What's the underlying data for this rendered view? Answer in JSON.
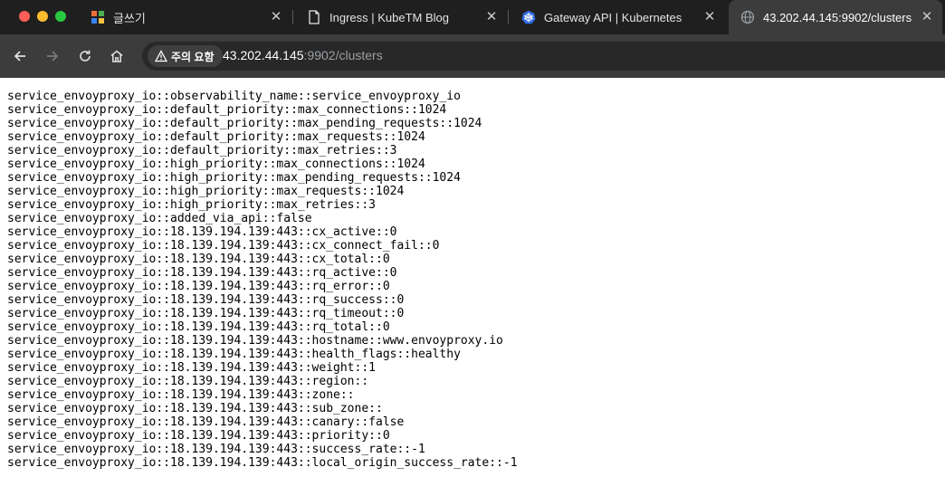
{
  "browser": {
    "tabs": [
      {
        "title": "글쓰기",
        "icon": "grid-app-icon"
      },
      {
        "title": "Ingress | KubeTM Blog",
        "icon": "document-icon"
      },
      {
        "title": "Gateway API | Kubernetes",
        "icon": "kubernetes-icon"
      },
      {
        "title": "43.202.44.145:9902/clusters",
        "icon": "globe-icon"
      }
    ],
    "security_chip": "주의 요함",
    "url_host": "43.202.44.145",
    "url_rest": ":9902/clusters"
  },
  "content": {
    "lines": [
      "service_envoyproxy_io::observability_name::service_envoyproxy_io",
      "service_envoyproxy_io::default_priority::max_connections::1024",
      "service_envoyproxy_io::default_priority::max_pending_requests::1024",
      "service_envoyproxy_io::default_priority::max_requests::1024",
      "service_envoyproxy_io::default_priority::max_retries::3",
      "service_envoyproxy_io::high_priority::max_connections::1024",
      "service_envoyproxy_io::high_priority::max_pending_requests::1024",
      "service_envoyproxy_io::high_priority::max_requests::1024",
      "service_envoyproxy_io::high_priority::max_retries::3",
      "service_envoyproxy_io::added_via_api::false",
      "service_envoyproxy_io::18.139.194.139:443::cx_active::0",
      "service_envoyproxy_io::18.139.194.139:443::cx_connect_fail::0",
      "service_envoyproxy_io::18.139.194.139:443::cx_total::0",
      "service_envoyproxy_io::18.139.194.139:443::rq_active::0",
      "service_envoyproxy_io::18.139.194.139:443::rq_error::0",
      "service_envoyproxy_io::18.139.194.139:443::rq_success::0",
      "service_envoyproxy_io::18.139.194.139:443::rq_timeout::0",
      "service_envoyproxy_io::18.139.194.139:443::rq_total::0",
      "service_envoyproxy_io::18.139.194.139:443::hostname::www.envoyproxy.io",
      "service_envoyproxy_io::18.139.194.139:443::health_flags::healthy",
      "service_envoyproxy_io::18.139.194.139:443::weight::1",
      "service_envoyproxy_io::18.139.194.139:443::region::",
      "service_envoyproxy_io::18.139.194.139:443::zone::",
      "service_envoyproxy_io::18.139.194.139:443::sub_zone::",
      "service_envoyproxy_io::18.139.194.139:443::canary::false",
      "service_envoyproxy_io::18.139.194.139:443::priority::0",
      "service_envoyproxy_io::18.139.194.139:443::success_rate::-1",
      "service_envoyproxy_io::18.139.194.139:443::local_origin_success_rate::-1"
    ]
  }
}
